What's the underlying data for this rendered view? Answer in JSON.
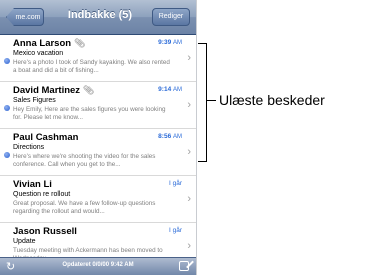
{
  "navbar": {
    "back_label": "me.com",
    "title": "Indbakke (5)",
    "edit_label": "Rediger"
  },
  "messages": [
    {
      "sender": "Anna Larson",
      "has_attachment": true,
      "time": "9:39",
      "ampm": "AM",
      "subject": "Mexico vacation",
      "preview": "Here's a photo I took of Sandy kayaking. We also rented a boat and did a bit of fishing...",
      "unread": true
    },
    {
      "sender": "David Martinez",
      "has_attachment": true,
      "time": "9:14",
      "ampm": "AM",
      "subject": "Sales Figures",
      "preview": "Hey Emily, Here are the sales figures you were looking for. Please let me know...",
      "unread": true
    },
    {
      "sender": "Paul Cashman",
      "has_attachment": false,
      "time": "8:56",
      "ampm": "AM",
      "subject": "Directions",
      "preview": "Here's where we're shooting the video for the sales conference. Call when you get to the...",
      "unread": true
    },
    {
      "sender": "Vivian Li",
      "has_attachment": false,
      "time": "I går",
      "ampm": "",
      "subject": "Question re rollout",
      "preview": "Great proposal. We have a few follow-up questions regarding the rollout and would...",
      "unread": false
    },
    {
      "sender": "Jason Russell",
      "has_attachment": false,
      "time": "I går",
      "ampm": "",
      "subject": "Update",
      "preview": "Tuesday meeting with Ackermann has been moved to Wednesday.",
      "unread": false
    }
  ],
  "toolbar": {
    "updated_text": "Opdateret 0/0/00 9:42 AM"
  },
  "callout": {
    "label": "Ulæste beskeder"
  },
  "colors": {
    "unread_dot": "#2c62d0",
    "time_blue": "#2a6ad8",
    "navbar": "#7b90b0"
  },
  "icons": {
    "attachment": "paperclip-icon",
    "refresh": "refresh-icon",
    "compose": "compose-icon",
    "disclosure": "chevron-right-icon"
  }
}
